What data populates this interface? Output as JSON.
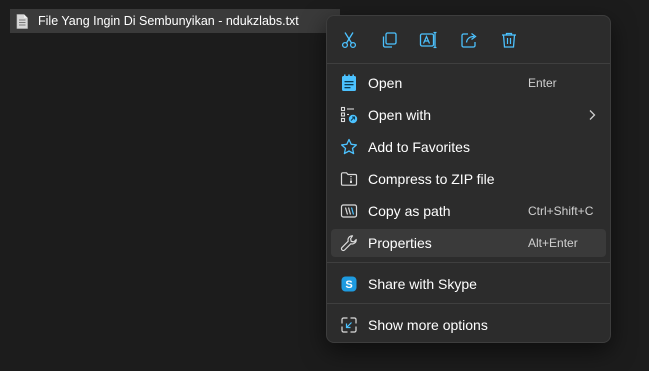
{
  "file": {
    "name": "File Yang Ingin Di Sembunyikan - ndukzlabs.txt",
    "icon": "text-file-icon"
  },
  "quick_actions": [
    {
      "name": "cut",
      "icon": "scissors-icon"
    },
    {
      "name": "copy",
      "icon": "copy-icon"
    },
    {
      "name": "rename",
      "icon": "rename-icon"
    },
    {
      "name": "share",
      "icon": "share-icon"
    },
    {
      "name": "delete",
      "icon": "trash-icon"
    }
  ],
  "menu": {
    "open": {
      "label": "Open",
      "shortcut": "Enter",
      "icon": "notepad-icon"
    },
    "open_with": {
      "label": "Open with",
      "icon": "open-with-icon"
    },
    "add_favorites": {
      "label": "Add to Favorites",
      "icon": "star-icon"
    },
    "compress_zip": {
      "label": "Compress to ZIP file",
      "icon": "zip-folder-icon"
    },
    "copy_path": {
      "label": "Copy as path",
      "shortcut": "Ctrl+Shift+C",
      "icon": "copy-path-icon"
    },
    "properties": {
      "label": "Properties",
      "shortcut": "Alt+Enter",
      "icon": "wrench-icon"
    },
    "share_skype": {
      "label": "Share with Skype",
      "icon": "skype-icon"
    },
    "more_options": {
      "label": "Show more options",
      "icon": "more-options-icon"
    }
  },
  "colors": {
    "background": "#1c1c1c",
    "menu_bg": "#2c2c2c",
    "accent": "#4cc2ff",
    "hover": "#3a3a3a",
    "skype": "#1e9be0"
  }
}
